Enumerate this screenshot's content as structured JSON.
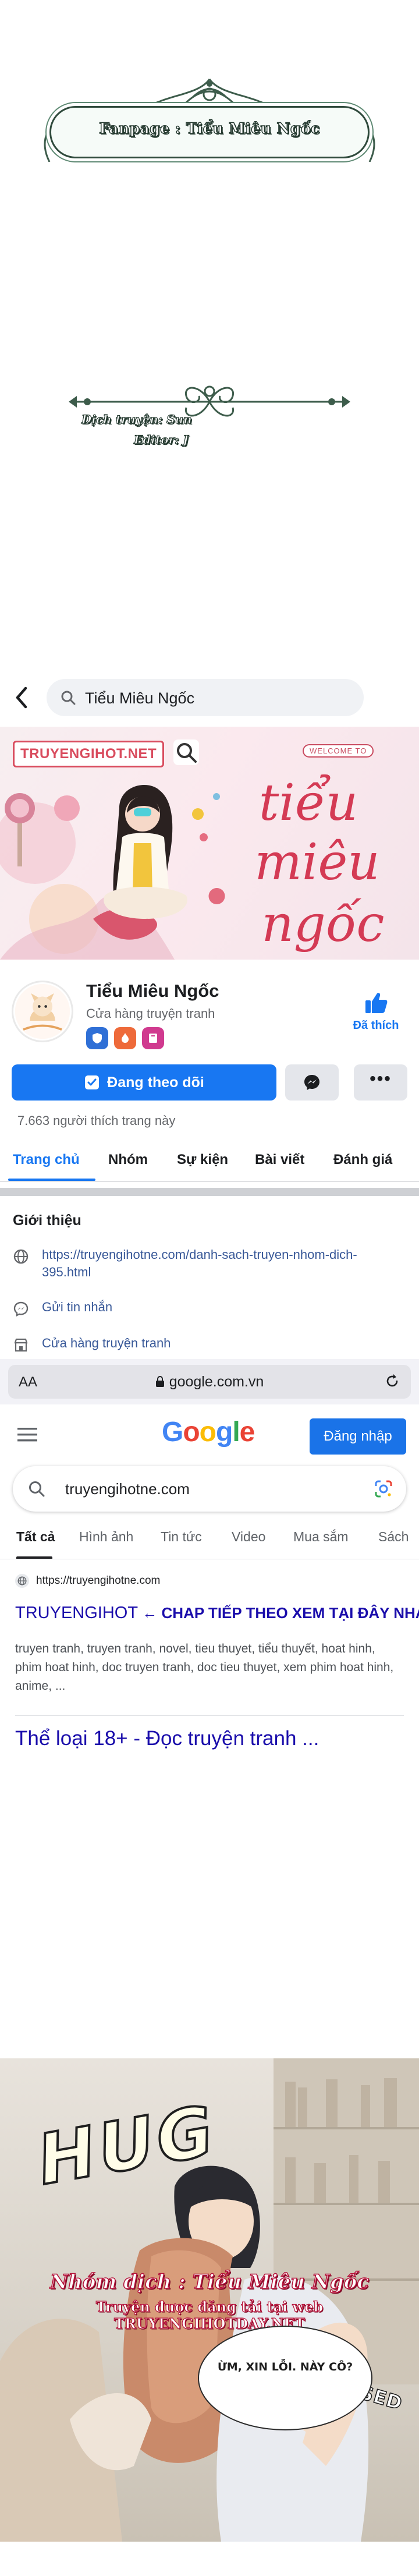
{
  "credits": {
    "fanpage": "Fanpage : Tiểu Miêu Ngốc",
    "translator": "Dịch truyện: Sun",
    "editor": "Editor: J"
  },
  "facebook": {
    "search_text": "Tiểu Miêu Ngốc",
    "cover_watermark": "TRUYENGIHOT.NET",
    "cover_welcome": "WELCOME TO",
    "cover_title": "tiểu miêu ngốc",
    "page_name": "Tiểu Miêu Ngốc",
    "page_category": "Cửa hàng truyện tranh",
    "liked_label": "Đã thích",
    "follow_label": "Đang theo dõi",
    "more_label": "•••",
    "like_count": "7.663 người thích trang này",
    "tabs": [
      "Trang chủ",
      "Nhóm",
      "Sự kiện",
      "Bài viết",
      "Đánh giá"
    ],
    "active_tab": "Trang chủ",
    "intro_title": "Giới thiệu",
    "intro_rows": [
      {
        "icon": "globe-icon",
        "text": "https://truyengihotne.com/danh-sach-truyen-nhom-dich-395.html"
      },
      {
        "icon": "messenger-icon",
        "text": "Gửi tin nhắn"
      },
      {
        "icon": "shop-icon",
        "text": "Cửa hàng truyện tranh"
      }
    ],
    "accent_color": "#1877f2"
  },
  "browser": {
    "aa_label": "AA",
    "url": "google.com.vn"
  },
  "google": {
    "logo": "Google",
    "signin_label": "Đăng nhập",
    "query": "truyengihotne.com",
    "tabs": [
      "Tất cả",
      "Hình ảnh",
      "Tin tức",
      "Video",
      "Mua sắm",
      "Sách"
    ],
    "active_tab": "Tất cả",
    "result_source": "https://truyengihotne.com",
    "result_title_main": "TRUYENGIHOT",
    "result_title_extra": " ← CHAP TIẾP THEO XEM TẠI ĐÂY NHA",
    "result_snippet": "truyen tranh, truyen tranh, novel, tieu thuyet, tiểu thuyết, hoat hinh, phim hoat hinh, doc truyen tranh, doc tieu thuyet, xem phim hoat hinh, anime, ...",
    "result2_title": "Thể loại 18+ - Đọc truyện tranh ...",
    "link_color": "#1a0dab"
  },
  "comic": {
    "sfx_hug": "HUG",
    "group_credit": "Nhóm dịch : Tiểu Miêu Ngốc",
    "upload_credit": "Truyện được đăng tải tại web TRUYENGIHOTDAY.NET",
    "sfx_confused": "CONFUSED",
    "speech": "ỪM, XIN LỖI. NÀY CÔ?"
  }
}
